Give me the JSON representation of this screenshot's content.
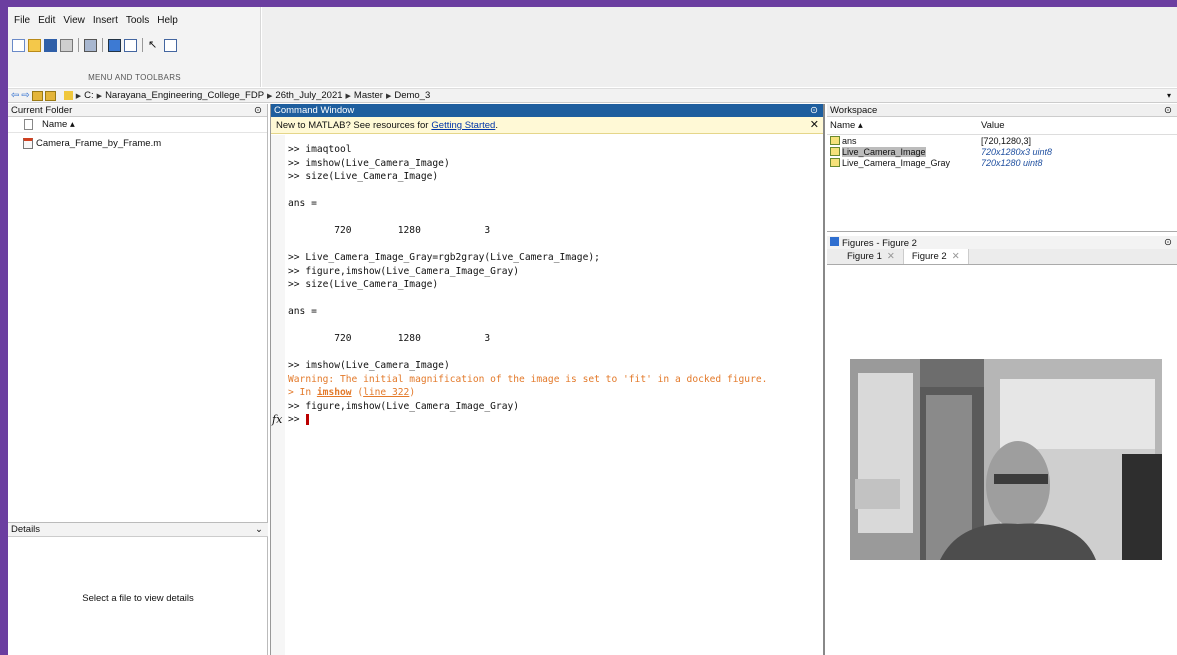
{
  "menu": {
    "items": [
      "File",
      "Edit",
      "View",
      "Insert",
      "Tools",
      "Help"
    ],
    "toolbar_caption": "MENU AND TOOLBARS"
  },
  "address": {
    "crumbs": [
      "C:",
      "Narayana_Engineering_College_FDP",
      "26th_July_2021",
      "Master",
      "Demo_3"
    ]
  },
  "current_folder": {
    "title": "Current Folder",
    "col_name": "Name ▴",
    "files": [
      "Camera_Frame_by_Frame.m"
    ]
  },
  "details": {
    "title": "Details",
    "message": "Select a file to view details"
  },
  "command_window": {
    "title": "Command Window",
    "notice": "New to MATLAB? See resources for",
    "notice_link": "Getting Started",
    "notice_end": ".",
    "lines": [
      ">> imaqtool",
      ">> imshow(Live_Camera_Image)",
      ">> size(Live_Camera_Image)",
      "",
      "ans =",
      "",
      "        720        1280           3",
      "",
      ">> Live_Camera_Image_Gray=rgb2gray(Live_Camera_Image);",
      ">> figure,imshow(Live_Camera_Image_Gray)",
      ">> size(Live_Camera_Image)",
      "",
      "ans =",
      "",
      "        720        1280           3",
      "",
      ">> imshow(Live_Camera_Image)"
    ],
    "warning": "Warning: The initial magnification of the image is set to 'fit' in a docked figure.",
    "in_prefix": "> In ",
    "in_func": "imshow",
    "in_line": "line 322",
    "in_close": ")",
    "after": ">> figure,imshow(Live_Camera_Image_Gray)",
    "prompt": ">>",
    "fx": "fx"
  },
  "workspace": {
    "title": "Workspace",
    "col_name": "Name ▴",
    "col_value": "Value",
    "rows": [
      {
        "name": "ans",
        "value": "[720,1280,3]"
      },
      {
        "name": "Live_Camera_Image",
        "value": "720x1280x3 uint8"
      },
      {
        "name": "Live_Camera_Image_Gray",
        "value": "720x1280 uint8"
      }
    ]
  },
  "figures": {
    "title": "Figures - Figure 2",
    "tabs": [
      "Figure 1",
      "Figure 2"
    ]
  },
  "colors": {
    "titlebar": "#1e5e9e",
    "frame": "#6b3ea0",
    "warning": "#e37a2b"
  }
}
